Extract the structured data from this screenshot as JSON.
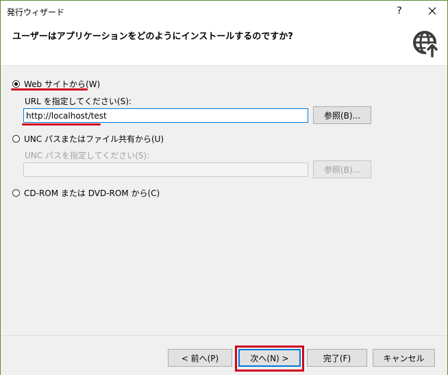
{
  "window": {
    "title": "発行ウィザード",
    "help_label": "?"
  },
  "header": {
    "question": "ユーザーはアプリケーションをどのようにインストールするのですか?",
    "icon": "globe-arrow-icon"
  },
  "options": {
    "web": {
      "label": "Web サイトから(W)",
      "selected": true,
      "url_label": "URL を指定してください(S):",
      "url_value": "http://localhost/test",
      "browse_label": "参照(B)..."
    },
    "unc": {
      "label": "UNC パスまたはファイル共有から(U)",
      "selected": false,
      "path_label": "UNC パスを指定してください(S):",
      "path_value": "",
      "browse_label": "参照(B)..."
    },
    "cdrom": {
      "label": "CD-ROM または DVD-ROM から(C)",
      "selected": false
    }
  },
  "footer": {
    "back_label": "< 前へ(P)",
    "next_label": "次へ(N) >",
    "finish_label": "完了(F)",
    "cancel_label": "キャンセル"
  },
  "colors": {
    "annotation_red": "#d0021b",
    "focus_blue": "#0078d7"
  }
}
